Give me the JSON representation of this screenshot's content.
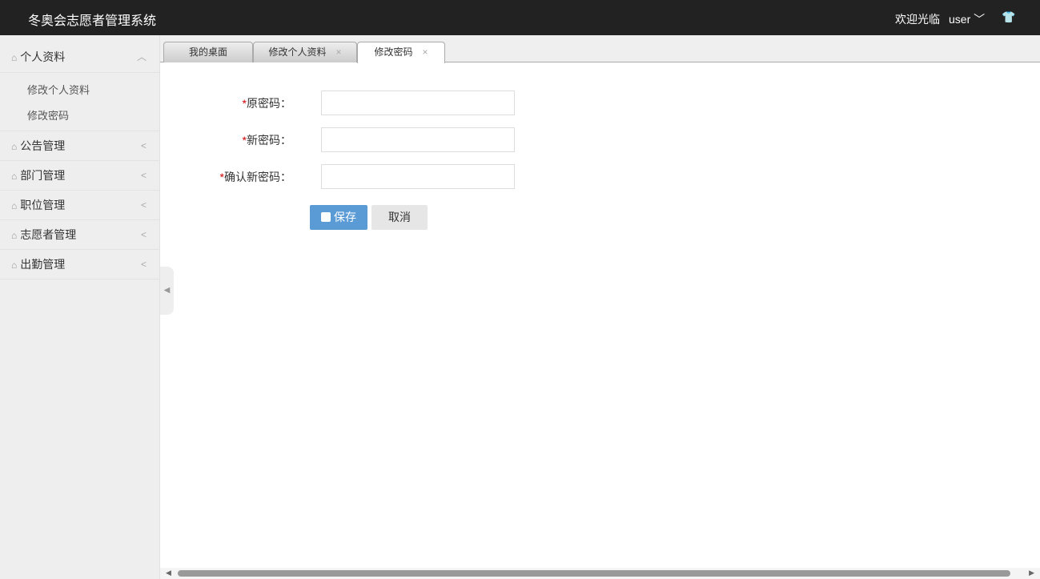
{
  "header": {
    "title": "冬奥会志愿者管理系统",
    "welcome": "欢迎光临",
    "user": "user",
    "user_chevron": "⌄",
    "skin_icon": "👕"
  },
  "sidebar": {
    "menus": [
      {
        "label": "个人资料",
        "arrow": "^",
        "children": [
          "修改个人资料",
          "修改密码"
        ]
      },
      {
        "label": "公告管理",
        "arrow": "<"
      },
      {
        "label": "部门管理",
        "arrow": "<"
      },
      {
        "label": "职位管理",
        "arrow": "<"
      },
      {
        "label": "志愿者管理",
        "arrow": "<"
      },
      {
        "label": "出勤管理",
        "arrow": "<"
      }
    ]
  },
  "tabs": [
    {
      "label": "我的桌面"
    },
    {
      "label": "修改个人资料",
      "close": "×"
    },
    {
      "label": "修改密码",
      "close": "×"
    }
  ],
  "form": {
    "required": "*",
    "old_password": "原密码：",
    "new_password": "新密码：",
    "confirm_password": "确认新密码：",
    "save": "保存",
    "cancel": "取消"
  }
}
